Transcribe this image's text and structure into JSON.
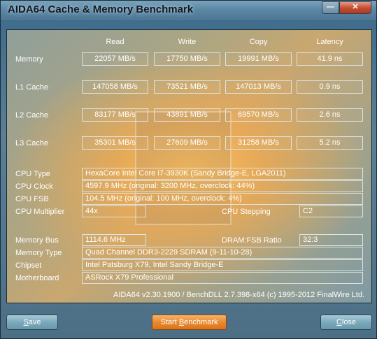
{
  "window": {
    "title": "AIDA64 Cache & Memory Benchmark",
    "minimize_glyph": "—",
    "close_glyph": "✕"
  },
  "columns": [
    "Read",
    "Write",
    "Copy",
    "Latency"
  ],
  "benchmark_rows": [
    {
      "label": "Memory",
      "read": "22057 MB/s",
      "write": "17750 MB/s",
      "copy": "19991 MB/s",
      "latency": "41.9 ns"
    },
    {
      "label": "L1 Cache",
      "read": "147058 MB/s",
      "write": "73521 MB/s",
      "copy": "147013 MB/s",
      "latency": "0.9 ns"
    },
    {
      "label": "L2 Cache",
      "read": "83177 MB/s",
      "write": "43891 MB/s",
      "copy": "69570 MB/s",
      "latency": "2.6 ns"
    },
    {
      "label": "L3 Cache",
      "read": "35301 MB/s",
      "write": "27609 MB/s",
      "copy": "31258 MB/s",
      "latency": "5.2 ns"
    }
  ],
  "cpu": {
    "type_label": "CPU Type",
    "type_value": "HexaCore Intel Core i7-3930K  (Sandy Bridge-E, LGA2011)",
    "clock_label": "CPU Clock",
    "clock_value": "4597.9 MHz  (original: 3200 MHz, overclock: 44%)",
    "fsb_label": "CPU FSB",
    "fsb_value": "104.5 MHz  (original: 100 MHz, overclock: 4%)",
    "multiplier_label": "CPU Multiplier",
    "multiplier_value": "44x",
    "stepping_label": "CPU Stepping",
    "stepping_value": "C2"
  },
  "memory": {
    "bus_label": "Memory Bus",
    "bus_value": "1114.6 MHz",
    "ratio_label": "DRAM:FSB Ratio",
    "ratio_value": "32:3",
    "type_label": "Memory Type",
    "type_value": "Quad Channel DDR3-2229 SDRAM  (9-11-10-28)",
    "chipset_label": "Chipset",
    "chipset_value": "Intel Patsburg X79, Intel Sandy Bridge-E",
    "motherboard_label": "Motherboard",
    "motherboard_value": "ASRock X79 Professional"
  },
  "footer": "AIDA64 v2.30.1900 / BenchDLL 2.7.398-x64  (c) 1995-2012 FinalWire Ltd.",
  "buttons": {
    "save_prefix": "S",
    "save_rest": "ave",
    "start_prefix": "Start ",
    "start_u": "B",
    "start_rest": "enchmark",
    "close_u": "C",
    "close_rest": "lose"
  },
  "colors": {
    "accent_start": "#e9892f",
    "panel_glow": "#f0aa50"
  }
}
